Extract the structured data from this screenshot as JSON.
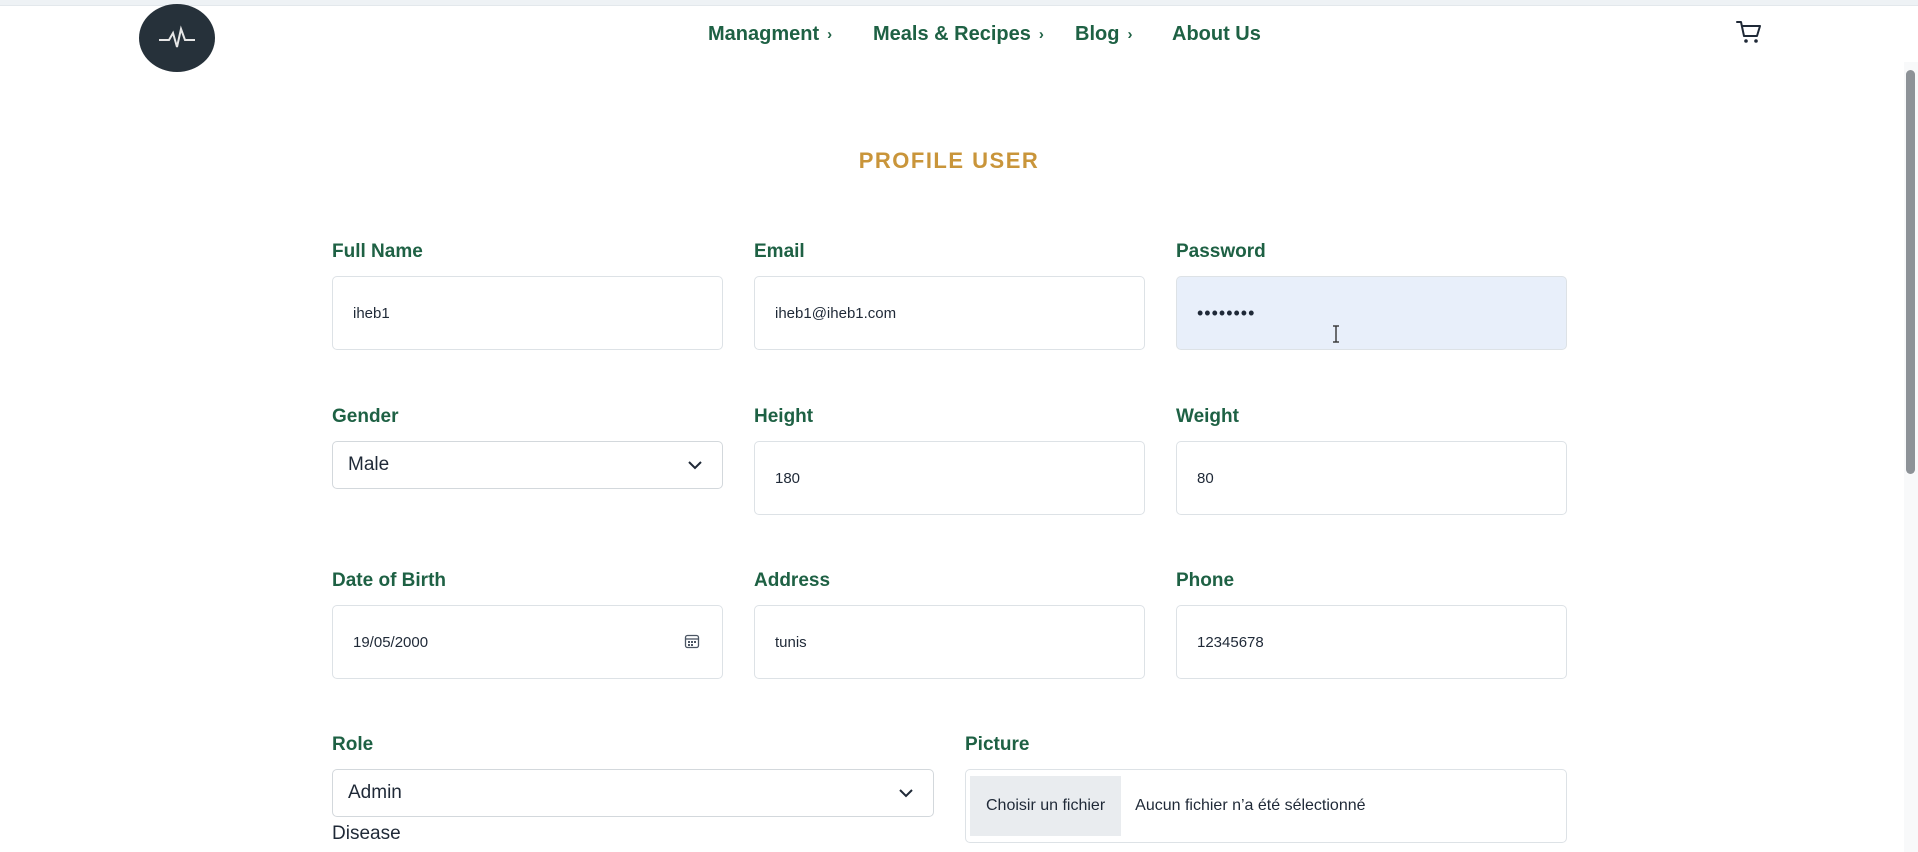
{
  "nav": {
    "items": [
      {
        "label": "Managment",
        "has_chevron": true
      },
      {
        "label": "Meals & Recipes",
        "has_chevron": true
      },
      {
        "label": "Blog",
        "has_chevron": true
      },
      {
        "label": "About Us",
        "has_chevron": false
      }
    ],
    "chevron_glyph": "›",
    "cart_icon": "cart-icon",
    "logo_icon": "heartbeat-logo-icon"
  },
  "page": {
    "title": "PROFILE USER"
  },
  "form": {
    "full_name": {
      "label": "Full Name",
      "value": "iheb1"
    },
    "email": {
      "label": "Email",
      "value": "iheb1@iheb1.com"
    },
    "password": {
      "label": "Password",
      "value": "••••••••"
    },
    "gender": {
      "label": "Gender",
      "value": "Male"
    },
    "height": {
      "label": "Height",
      "value": "180"
    },
    "weight": {
      "label": "Weight",
      "value": "80"
    },
    "date_of_birth": {
      "label": "Date of Birth",
      "value": "19/05/2000"
    },
    "address": {
      "label": "Address",
      "value": "tunis"
    },
    "phone": {
      "label": "Phone",
      "value": "12345678"
    },
    "role": {
      "label": "Role",
      "value": "Admin"
    },
    "picture": {
      "label": "Picture",
      "button": "Choisir un fichier",
      "status": "Aucun fichier n’a été sélectionné"
    },
    "disease": {
      "label": "Disease"
    }
  },
  "colors": {
    "accent_green": "#1e6144",
    "title_gold": "#c9953a",
    "password_fill": "#e8effa",
    "logo_bg": "#26313a"
  }
}
